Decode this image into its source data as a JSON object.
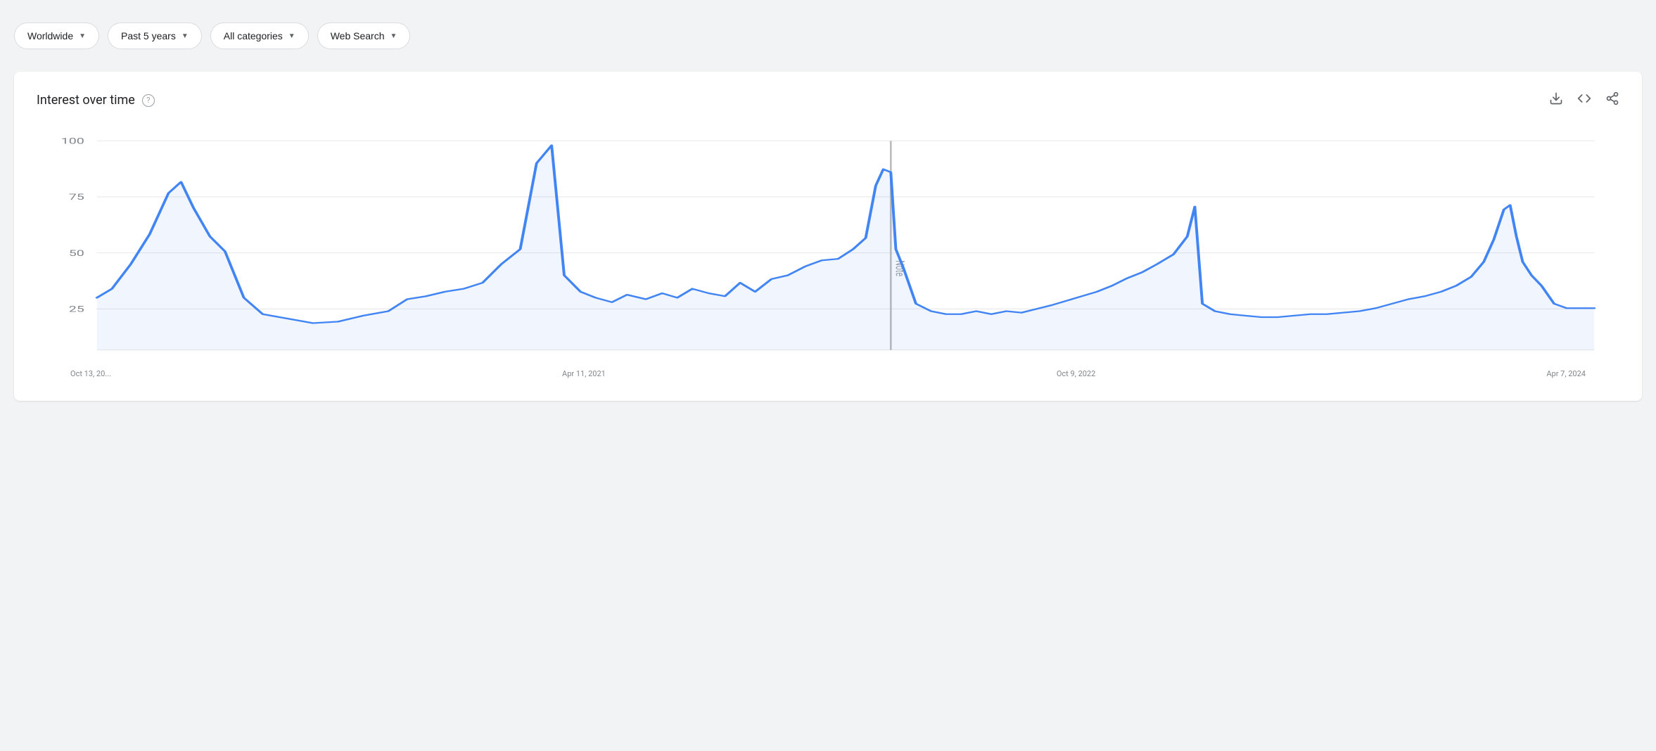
{
  "filters": [
    {
      "id": "worldwide",
      "label": "Worldwide"
    },
    {
      "id": "past5years",
      "label": "Past 5 years"
    },
    {
      "id": "allcategories",
      "label": "All categories"
    },
    {
      "id": "websearch",
      "label": "Web Search"
    }
  ],
  "card": {
    "title": "Interest over time",
    "help_label": "?",
    "actions": {
      "download": "⬇",
      "embed": "<>",
      "share": "share"
    }
  },
  "chart": {
    "y_labels": [
      "100",
      "75",
      "50",
      "25"
    ],
    "x_labels": [
      "Oct 13, 20...",
      "Apr 11, 2021",
      "Oct 9, 2022",
      "Apr 7, 2024"
    ],
    "note_label": "Note",
    "accent_color": "#4285f4",
    "grid_color": "#e0e0e0",
    "line_color": "#4285f4",
    "note_line_color": "#9aa0a6"
  }
}
